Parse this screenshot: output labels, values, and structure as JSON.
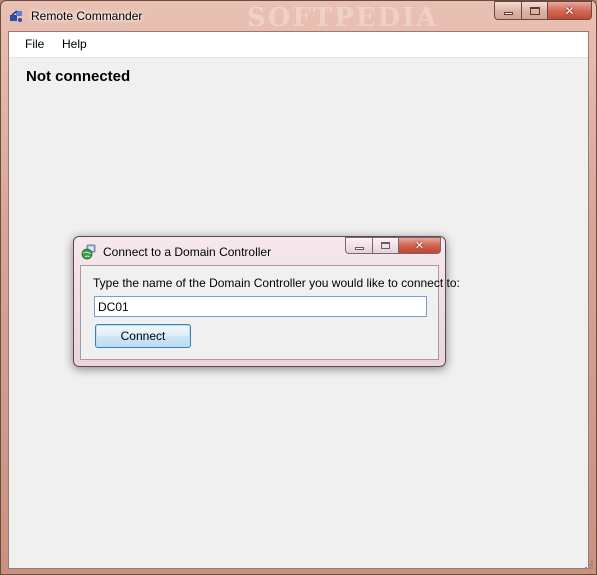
{
  "window": {
    "title": "Remote Commander",
    "watermark": "SOFTPEDIA"
  },
  "menu": {
    "items": [
      {
        "label": "File"
      },
      {
        "label": "Help"
      }
    ]
  },
  "main": {
    "status": "Not connected"
  },
  "dialog": {
    "title": "Connect to a Domain Controller",
    "prompt": "Type the name of the Domain Controller you would like to connect to:",
    "input_value": "DC01",
    "button_label": "Connect"
  },
  "icons": {
    "app": "remote-commander-app-icon",
    "dialog": "network-globe-icon"
  },
  "colors": {
    "frame": "#d7a596",
    "client_bg": "#f0f0f0",
    "close_button": "#c24b36",
    "button_border": "#3c7fb1"
  }
}
